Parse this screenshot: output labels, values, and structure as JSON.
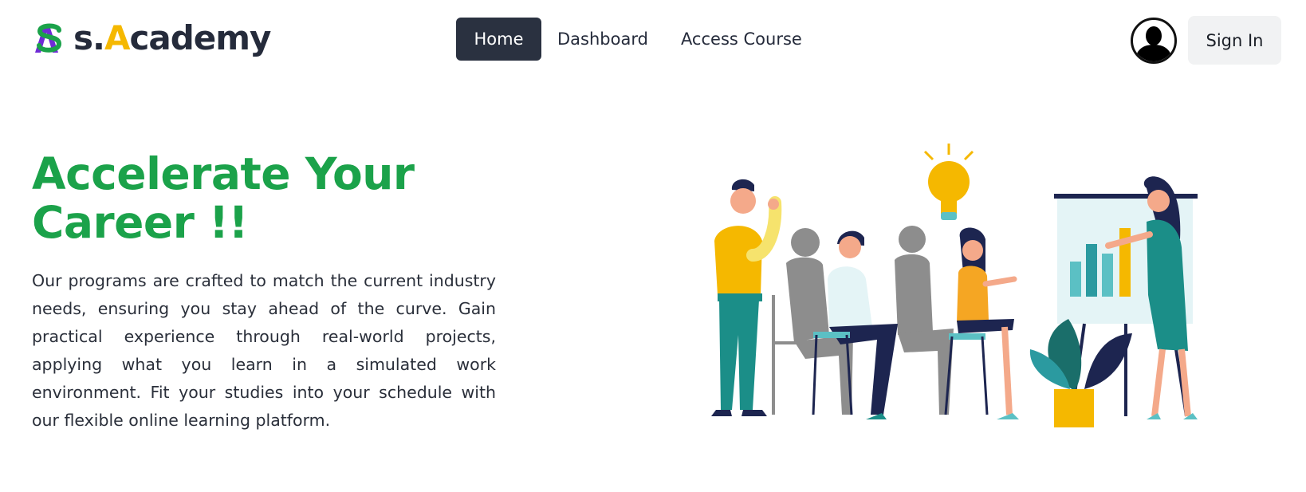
{
  "brand": {
    "name_prefix": "s.",
    "name_accent": "A",
    "name_rest": "cademy",
    "colors": {
      "green": "#1ba24a",
      "purple": "#6f2bd6",
      "yellow": "#f5b800",
      "dark": "#252b3b"
    }
  },
  "nav": {
    "items": [
      {
        "label": "Home",
        "active": true
      },
      {
        "label": "Dashboard",
        "active": false
      },
      {
        "label": "Access Course",
        "active": false
      }
    ]
  },
  "header": {
    "avatar_icon": "user-silhouette-icon",
    "signin_label": "Sign In"
  },
  "hero": {
    "title": "Accelerate Your Career !!",
    "description": "Our programs are crafted to match the current industry needs, ensuring you stay ahead of the curve. Gain practical experience through real-world projects, applying what you learn in a simulated work environment. Fit your studies into your schedule with our flexible online learning platform.",
    "illustration": "team-meeting-illustration"
  }
}
